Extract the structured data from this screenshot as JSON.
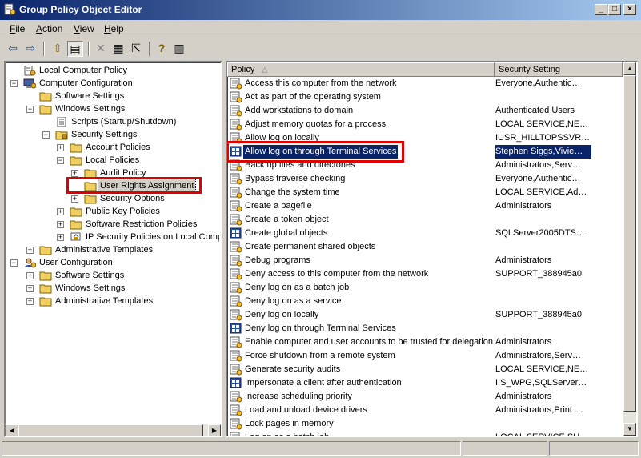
{
  "window": {
    "title": "Group Policy Object Editor",
    "buttons": {
      "minimize": "_",
      "maximize": "□",
      "close": "×"
    }
  },
  "menu": [
    {
      "label": "File",
      "accel": "F",
      "rest": "ile"
    },
    {
      "label": "Action",
      "accel": "A",
      "rest": "ction"
    },
    {
      "label": "View",
      "accel": "V",
      "rest": "iew"
    },
    {
      "label": "Help",
      "accel": "H",
      "rest": "elp"
    }
  ],
  "toolbar": {
    "back_glyph": "⇦",
    "forward_glyph": "⇨",
    "up_glyph": "⇧",
    "tree_glyph": "▤",
    "delete_glyph": "✕",
    "properties_glyph": "▦",
    "export_glyph": "⇱",
    "help_glyph": "?",
    "console_glyph": "▥"
  },
  "tree": {
    "items": [
      {
        "label": "Local Computer Policy",
        "icon": "policy-icon"
      },
      {
        "label": "Computer Configuration",
        "icon": "computer-icon",
        "expander": "−"
      },
      {
        "label": "Software Settings",
        "icon": "folder-icon"
      },
      {
        "label": "Windows Settings",
        "icon": "folder-icon",
        "expander": "−"
      },
      {
        "label": "Scripts (Startup/Shutdown)",
        "icon": "script-icon"
      },
      {
        "label": "Security Settings",
        "icon": "lock-folder-icon",
        "expander": "−"
      },
      {
        "label": "Account Policies",
        "icon": "folder-icon",
        "expander": "+"
      },
      {
        "label": "Local Policies",
        "icon": "folder-icon",
        "expander": "−"
      },
      {
        "label": "Audit Policy",
        "icon": "folder-icon",
        "expander": "+"
      },
      {
        "label": "User Rights Assignment",
        "icon": "folder-icon",
        "selected": true
      },
      {
        "label": "Security Options",
        "icon": "folder-icon",
        "expander": "+"
      },
      {
        "label": "Public Key Policies",
        "icon": "folder-icon",
        "expander": "+"
      },
      {
        "label": "Software Restriction Policies",
        "icon": "folder-icon",
        "expander": "+"
      },
      {
        "label": "IP Security Policies on Local Comput",
        "icon": "ipsec-icon",
        "expander": "+"
      },
      {
        "label": "Administrative Templates",
        "icon": "folder-icon",
        "expander": "+"
      },
      {
        "label": "User Configuration",
        "icon": "user-icon",
        "expander": "−"
      },
      {
        "label": "Software Settings",
        "icon": "folder-icon",
        "expander": "+"
      },
      {
        "label": "Windows Settings",
        "icon": "folder-icon",
        "expander": "+"
      },
      {
        "label": "Administrative Templates",
        "icon": "folder-icon",
        "expander": "+"
      }
    ]
  },
  "list": {
    "columns": {
      "policy": "Policy",
      "sort_glyph": "△",
      "setting": "Security Setting"
    },
    "rows": [
      {
        "policy": "Access this computer from the network",
        "setting": "Everyone,Authentic…"
      },
      {
        "policy": "Act as part of the operating system",
        "setting": ""
      },
      {
        "policy": "Add workstations to domain",
        "setting": "Authenticated Users"
      },
      {
        "policy": "Adjust memory quotas for a process",
        "setting": "LOCAL SERVICE,NE…"
      },
      {
        "policy": "Allow log on locally",
        "setting": "IUSR_HILLTOPSSVR…"
      },
      {
        "policy": "Allow log on through Terminal Services",
        "setting": "Stephen Siggs,Vivie…",
        "selected": true
      },
      {
        "policy": "Back up files and directories",
        "setting": "Administrators,Serv…"
      },
      {
        "policy": "Bypass traverse checking",
        "setting": "Everyone,Authentic…"
      },
      {
        "policy": "Change the system time",
        "setting": "LOCAL SERVICE,Ad…"
      },
      {
        "policy": "Create a pagefile",
        "setting": "Administrators"
      },
      {
        "policy": "Create a token object",
        "setting": ""
      },
      {
        "policy": "Create global objects",
        "setting": "SQLServer2005DTS…"
      },
      {
        "policy": "Create permanent shared objects",
        "setting": ""
      },
      {
        "policy": "Debug programs",
        "setting": "Administrators"
      },
      {
        "policy": "Deny access to this computer from the network",
        "setting": "SUPPORT_388945a0"
      },
      {
        "policy": "Deny log on as a batch job",
        "setting": ""
      },
      {
        "policy": "Deny log on as a service",
        "setting": ""
      },
      {
        "policy": "Deny log on locally",
        "setting": "SUPPORT_388945a0"
      },
      {
        "policy": "Deny log on through Terminal Services",
        "setting": ""
      },
      {
        "policy": "Enable computer and user accounts to be trusted for delegation",
        "setting": "Administrators"
      },
      {
        "policy": "Force shutdown from a remote system",
        "setting": "Administrators,Serv…"
      },
      {
        "policy": "Generate security audits",
        "setting": "LOCAL SERVICE,NE…"
      },
      {
        "policy": "Impersonate a client after authentication",
        "setting": "IIS_WPG,SQLServer…"
      },
      {
        "policy": "Increase scheduling priority",
        "setting": "Administrators"
      },
      {
        "policy": "Load and unload device drivers",
        "setting": "Administrators,Print …"
      },
      {
        "policy": "Lock pages in memory",
        "setting": ""
      },
      {
        "policy": "Log on as a batch job",
        "setting": "LOCAL SERVICE,SU…"
      }
    ]
  },
  "colors": {
    "title_start": "#0a246a",
    "title_end": "#a6caf0",
    "selection": "#0a246a",
    "highlight_box": "#e00000",
    "chrome": "#d4d0c8"
  }
}
